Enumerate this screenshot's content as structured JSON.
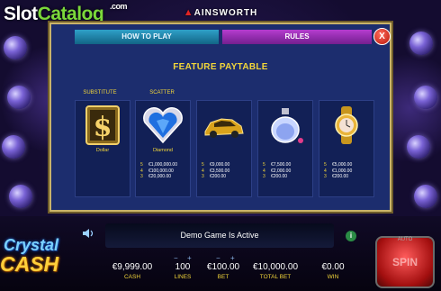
{
  "watermark": {
    "slot": "Slot",
    "catalog": "Catalog",
    "com": ".com"
  },
  "brand": {
    "name": "AINSWORTH"
  },
  "tabs": {
    "how_to_play": "HOW TO PLAY",
    "rules": "RULES",
    "close_symbol": "X"
  },
  "paytable": {
    "title": "FEATURE PAYTABLE",
    "columns": [
      {
        "header": "SUBSTITUTE",
        "symbol": "Dollar",
        "icon": "dollar-sign-icon",
        "pays": []
      },
      {
        "header": "SCATTER",
        "symbol": "Diamond",
        "icon": "diamond-heart-icon",
        "pays": [
          {
            "n": "5",
            "v": "€1,000,000.00"
          },
          {
            "n": "4",
            "v": "€100,000.00"
          },
          {
            "n": "3",
            "v": "€20,000.00"
          }
        ]
      },
      {
        "header": "",
        "symbol": "",
        "icon": "gold-car-icon",
        "pays": [
          {
            "n": "5",
            "v": "€9,000.00"
          },
          {
            "n": "4",
            "v": "€3,500.00"
          },
          {
            "n": "3",
            "v": "€200.00"
          }
        ]
      },
      {
        "header": "",
        "symbol": "",
        "icon": "perfume-icon",
        "pays": [
          {
            "n": "5",
            "v": "€7,500.00"
          },
          {
            "n": "4",
            "v": "€2,000.00"
          },
          {
            "n": "3",
            "v": "€200.00"
          }
        ]
      },
      {
        "header": "",
        "symbol": "",
        "icon": "gold-watch-icon",
        "pays": [
          {
            "n": "5",
            "v": "€5,000.00"
          },
          {
            "n": "4",
            "v": "€1,000.00"
          },
          {
            "n": "3",
            "v": "€200.00"
          }
        ]
      }
    ]
  },
  "logo": {
    "line1": "Crystal",
    "line2": "CASH"
  },
  "status": {
    "message": "Demo Game Is Active",
    "info_symbol": "i"
  },
  "stats": {
    "cash": {
      "value": "€9,999.00",
      "label": "CASH"
    },
    "lines": {
      "value": "100",
      "label": "LINES"
    },
    "bet": {
      "value": "€100.00",
      "label": "BET"
    },
    "total_bet": {
      "value": "€10,000.00",
      "label": "TOTAL BET"
    },
    "win": {
      "value": "€0.00",
      "label": "WIN"
    }
  },
  "controls": {
    "minus": "−",
    "plus": "+",
    "auto": "AUTO",
    "spin": "SPIN"
  },
  "colors": {
    "accent_gold": "#f2d63a",
    "panel_blue": "#1c2d6e",
    "rules_tab": "#b53ccf",
    "how_tab": "#2fa0c8",
    "spin_red": "#d42020"
  }
}
